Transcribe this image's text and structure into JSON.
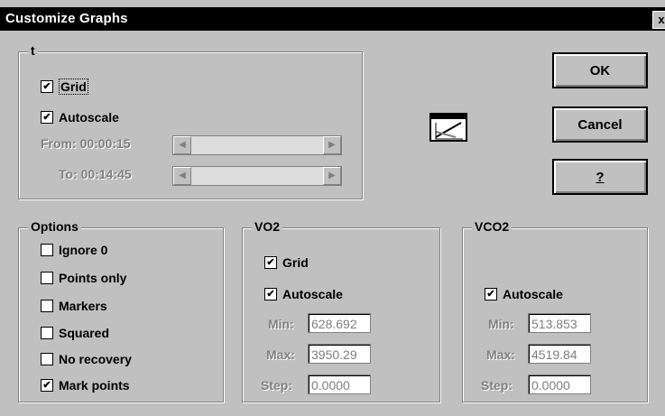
{
  "window": {
    "title": "Customize Graphs",
    "close_glyph": "x"
  },
  "t_group": {
    "legend": "t",
    "grid_label": "Grid",
    "grid_checked": true,
    "autoscale_label": "Autoscale",
    "autoscale_checked": true,
    "from_label": "From:",
    "from_value": "00:00:15",
    "to_label": "To:",
    "to_value": "00:14:45"
  },
  "buttons": {
    "ok": "OK",
    "cancel": "Cancel",
    "help": "?"
  },
  "icon": {
    "name": "graph-settings-icon"
  },
  "options": {
    "legend": "Options",
    "items": [
      {
        "label": "Ignore 0",
        "checked": false
      },
      {
        "label": "Points only",
        "checked": false
      },
      {
        "label": "Markers",
        "checked": false
      },
      {
        "label": "Squared",
        "checked": false
      },
      {
        "label": "No recovery",
        "checked": false
      },
      {
        "label": "Mark points",
        "checked": true
      }
    ]
  },
  "vo2": {
    "legend": "VO2",
    "grid_label": "Grid",
    "grid_checked": true,
    "autoscale_label": "Autoscale",
    "autoscale_checked": true,
    "min_label": "Min:",
    "min_value": "628.692",
    "max_label": "Max:",
    "max_value": "3950.29",
    "step_label": "Step:",
    "step_value": "0.0000"
  },
  "vco2": {
    "legend": "VCO2",
    "autoscale_label": "Autoscale",
    "autoscale_checked": true,
    "min_label": "Min:",
    "min_value": "513.853",
    "max_label": "Max:",
    "max_value": "4519.84",
    "step_label": "Step:",
    "step_value": "0.0000"
  },
  "colors": {
    "face": "#c0c0c0",
    "titlebar": "#000000",
    "disabled_text": "#808080"
  }
}
